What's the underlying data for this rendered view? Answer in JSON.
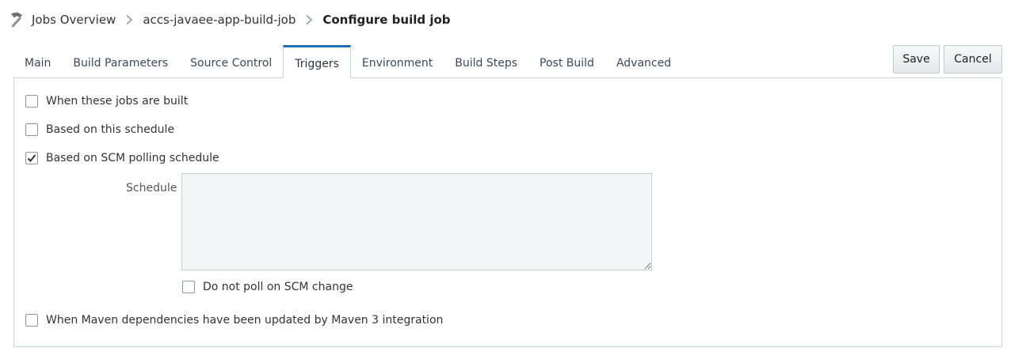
{
  "breadcrumb": {
    "icon": "hammer-icon",
    "items": [
      "Jobs Overview",
      "accs-javaee-app-build-job"
    ],
    "current": "Configure build job"
  },
  "tabs": [
    {
      "label": "Main",
      "active": false
    },
    {
      "label": "Build Parameters",
      "active": false
    },
    {
      "label": "Source Control",
      "active": false
    },
    {
      "label": "Triggers",
      "active": true
    },
    {
      "label": "Environment",
      "active": false
    },
    {
      "label": "Build Steps",
      "active": false
    },
    {
      "label": "Post Build",
      "active": false
    },
    {
      "label": "Advanced",
      "active": false
    }
  ],
  "actions": {
    "save_label": "Save",
    "cancel_label": "Cancel"
  },
  "triggers": {
    "when_jobs_built": {
      "label": "When these jobs are built",
      "checked": false
    },
    "based_on_schedule": {
      "label": "Based on this schedule",
      "checked": false
    },
    "scm_polling": {
      "label": "Based on SCM polling schedule",
      "checked": true
    },
    "schedule": {
      "label": "Schedule",
      "value": ""
    },
    "do_not_poll": {
      "label": "Do not poll on SCM change",
      "checked": false
    },
    "maven_deps": {
      "label": "When Maven dependencies have been updated by Maven 3 integration",
      "checked": false
    }
  },
  "colors": {
    "active_tab_accent": "#1f6fb2",
    "border": "#c9d1d9",
    "textarea_bg": "#f4f5f6"
  }
}
